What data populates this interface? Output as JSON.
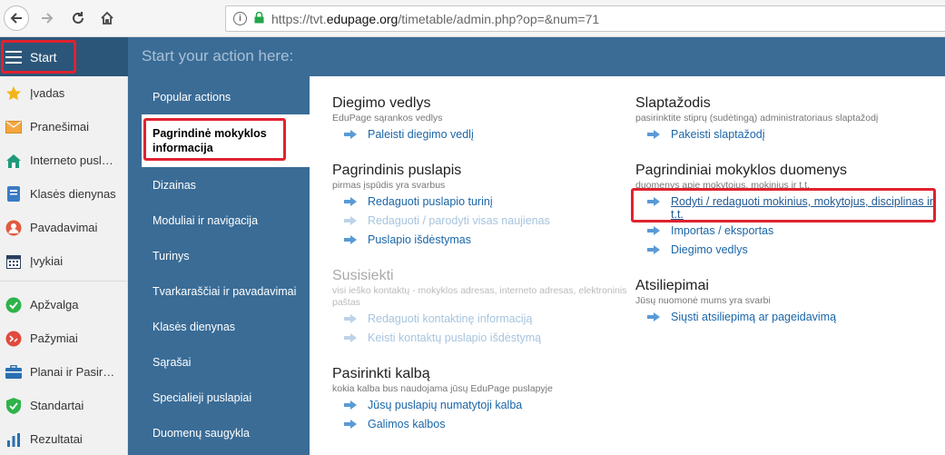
{
  "browser": {
    "url_scheme": "https://tvt.",
    "url_host": "edupage.org",
    "url_path": "/timetable/admin.php?op=&num=71"
  },
  "topbar": {
    "start_label": "Start",
    "title": "Start your action here:"
  },
  "sidebar": {
    "items": [
      {
        "label": "Įvadas",
        "icon": "star-icon"
      },
      {
        "label": "Pranešimai",
        "icon": "envelope-icon"
      },
      {
        "label": "Interneto pusl…",
        "icon": "house-icon"
      },
      {
        "label": "Klasės dienynas",
        "icon": "book-icon"
      },
      {
        "label": "Pavadavimai",
        "icon": "person-icon"
      },
      {
        "label": "Įvykiai",
        "icon": "calendar-icon"
      },
      {
        "label": "Apžvalga",
        "icon": "check-icon"
      },
      {
        "label": "Pažymiai",
        "icon": "grade-icon"
      },
      {
        "label": "Planai ir Pasir…",
        "icon": "briefcase-icon"
      },
      {
        "label": "Standartai",
        "icon": "shield-icon"
      },
      {
        "label": "Rezultatai",
        "icon": "bar-chart-icon"
      }
    ]
  },
  "nav2": {
    "items": [
      "Popular actions",
      "Pagrindinė mokyklos informacija",
      "Dizainas",
      "Moduliai ir navigacija",
      "Turinys",
      "Tvarkaraščiai ir pavadavimai",
      "Klasės dienynas",
      "Sąrašai",
      "Specialieji puslapiai",
      "Duomenų saugykla"
    ]
  },
  "main": {
    "diegimo": {
      "title": "Diegimo vedlys",
      "sub": "EduPage sąrankos vedlys",
      "a1": "Paleisti diegimo vedlį"
    },
    "pagrindinis": {
      "title": "Pagrindinis puslapis",
      "sub": "pirmas įspūdis yra svarbus",
      "a1": "Redaguoti puslapio turinį",
      "a2": "Redaguoti / parodyti visas naujienas",
      "a3": "Puslapio išdėstymas"
    },
    "susisiekti": {
      "title": "Susisiekti",
      "sub": "visi ieško kontaktų - mokyklos adresas, interneto adresas, elektroninis paštas",
      "a1": "Redaguoti kontaktinę informaciją",
      "a2": "Keisti kontaktų puslapio išdėstymą"
    },
    "kalba": {
      "title": "Pasirinkti kalbą",
      "sub": "kokia kalba bus naudojama jūsų EduPage puslapyje",
      "a1": "Jūsų puslapių numatytoji kalba",
      "a2": "Galimos kalbos"
    },
    "slaptazodis": {
      "title": "Slaptažodis",
      "sub": "pasirinktite stiprų (sudėtingą) administratoriaus slaptažodį",
      "a1": "Pakeisti slaptažodį"
    },
    "duomenys": {
      "title": "Pagrindiniai mokyklos duomenys",
      "sub": "duomenys apie mokytojus, mokinius ir t.t.",
      "a1": "Rodyti / redaguoti mokinius, mokytojus, disciplinas ir t.t.",
      "a2": "Importas / eksportas",
      "a3": "Diegimo vedlys"
    },
    "atsiliepimai": {
      "title": "Atsiliepimai",
      "sub": "Jūsų nuomonė mums yra svarbi",
      "a1": "Siųsti atsiliepimą ar pageidavimą"
    }
  },
  "colors": {
    "accent": "#3a6c96",
    "highlight": "#e0222f",
    "link": "#1a66a8"
  }
}
